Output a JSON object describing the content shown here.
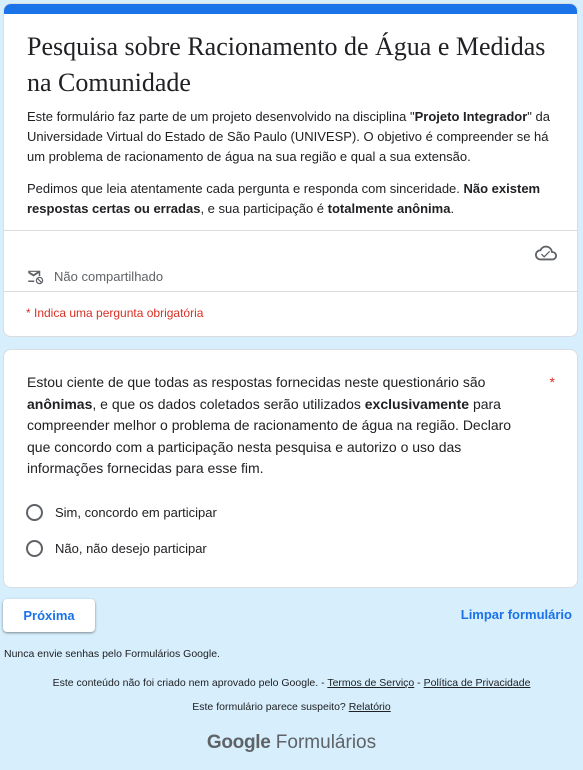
{
  "header": {
    "title": "Pesquisa sobre Racionamento de Água e Medidas na Comunidade",
    "description_1": {
      "part_1": "Este formulário faz parte de um projeto desenvolvido na disciplina \"",
      "bold_1": "Projeto Integrador",
      "part_2": "\" da Universidade Virtual do Estado de São Paulo (UNIVESP). O objetivo é compreender se há um problema de racionamento de água na sua região e qual a sua extensão."
    },
    "description_2": {
      "part_1": "Pedimos que leia atentamente cada pergunta e responda com sinceridade. ",
      "bold_1": "Não existem respostas certas ou erradas",
      "part_2": ", e sua participação é ",
      "bold_2": "totalmente anônima",
      "part_3": "."
    },
    "share_status": "Não compartilhado",
    "required_note": "* Indica uma pergunta obrigatória",
    "accent_color": "#1a73e8"
  },
  "question": {
    "text": {
      "part_1": "Estou ciente de que todas as respostas fornecidas neste questionário são ",
      "bold_1": "anônimas",
      "part_2": ", e que os dados coletados serão utilizados ",
      "bold_2": "exclusivamente",
      "part_3": " para compreender melhor o problema de racionamento de água na região. Declaro que concordo com a participação nesta pesquisa e autorizo o uso das informações fornecidas para esse fim."
    },
    "required_marker": "*",
    "options": [
      {
        "label": "Sim, concordo em participar"
      },
      {
        "label": "Não, não desejo participar"
      }
    ]
  },
  "actions": {
    "next_label": "Próxima",
    "clear_label": "Limpar formulário"
  },
  "footer": {
    "password_warning": "Nunca envie senhas pelo Formulários Google.",
    "disclaimer_text": "Este conteúdo não foi criado nem aprovado pelo Google. - ",
    "terms_label": "Termos de Serviço",
    "separator": " - ",
    "privacy_label": "Política de Privacidade",
    "suspicious_text": "Este formulário parece suspeito? ",
    "report_label": "Relatório",
    "brand_google": "Google",
    "brand_forms": " Formulários"
  },
  "icons": {
    "cloud": "cloud-sync-icon",
    "share": "not-shared-mail-icon"
  }
}
